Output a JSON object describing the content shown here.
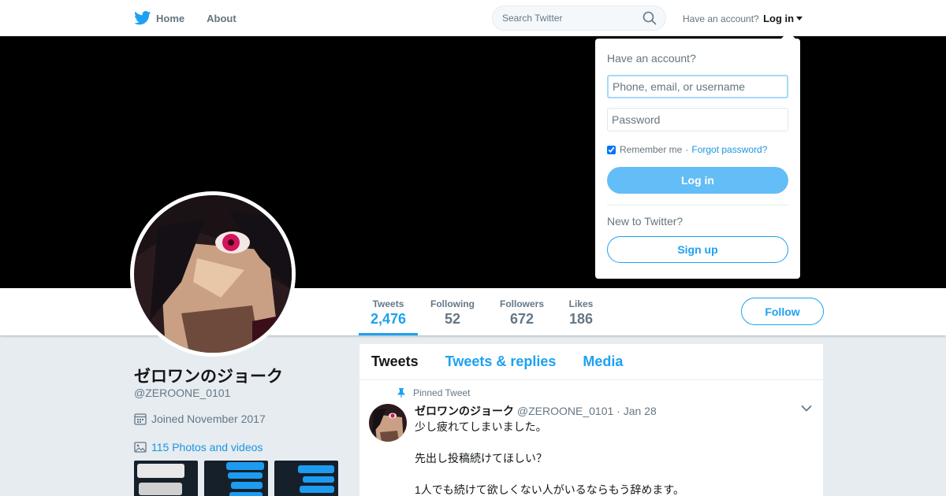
{
  "nav": {
    "home_label": "Home",
    "about_label": "About",
    "search_placeholder": "Search Twitter",
    "have_account": "Have an account?",
    "login_label": "Log in"
  },
  "profile": {
    "name": "ゼロワンのジョーク",
    "handle": "@ZEROONE_0101",
    "joined": "Joined November 2017",
    "photos_label": "115 Photos and videos",
    "follow_label": "Follow"
  },
  "stats": [
    {
      "label": "Tweets",
      "value": "2,476"
    },
    {
      "label": "Following",
      "value": "52"
    },
    {
      "label": "Followers",
      "value": "672"
    },
    {
      "label": "Likes",
      "value": "186"
    }
  ],
  "timeline": {
    "tabs": [
      "Tweets",
      "Tweets & replies",
      "Media"
    ]
  },
  "tweet": {
    "pinned_label": "Pinned Tweet",
    "name": "ゼロワンのジョーク",
    "handle": "@ZEROONE_0101",
    "date": "· Jan 28",
    "lines": [
      "少し疲れてしまいました。",
      "先出し投稿続けてほしい？",
      "1人でも続けて欲しくない人がいるならもう辞めます。"
    ]
  },
  "login_dropdown": {
    "title": "Have an account?",
    "username_placeholder": "Phone, email, or username",
    "password_placeholder": "Password",
    "remember_label": "Remember me",
    "separator": "·",
    "forgot_label": "Forgot password?",
    "login_button": "Log in",
    "new_label": "New to Twitter?",
    "signup_button": "Sign up"
  },
  "colors": {
    "brand_blue": "#1da1f2",
    "banner": "#000000",
    "background": "#e6ecf0"
  },
  "icons": {
    "logo": "twitter-bird-icon",
    "search": "search-icon",
    "calendar": "calendar-icon",
    "photos": "image-icon",
    "pin": "pin-icon",
    "more": "chevron-down-icon"
  }
}
